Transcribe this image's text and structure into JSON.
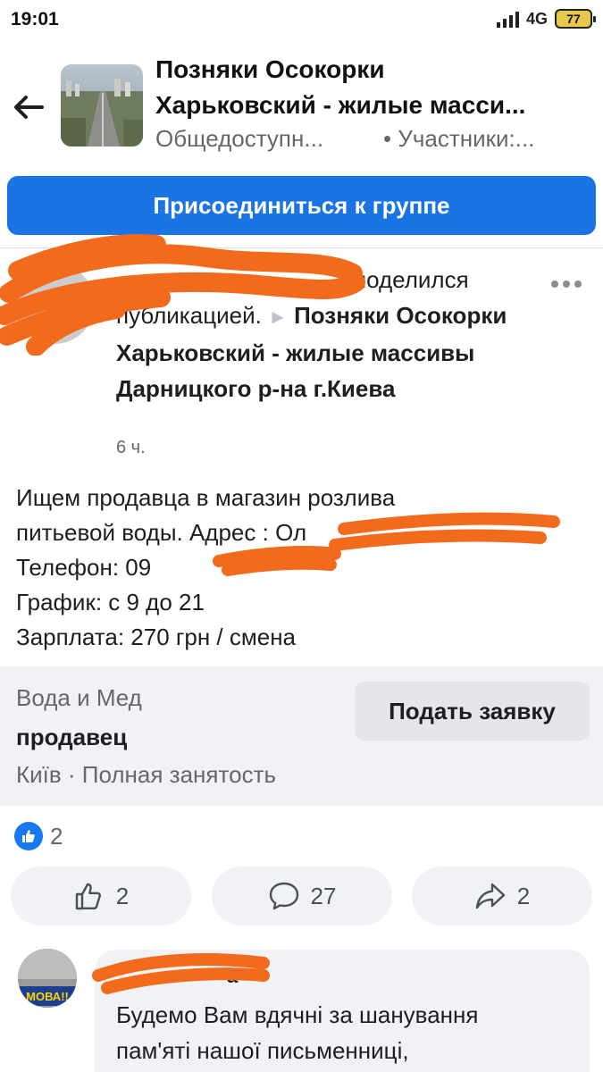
{
  "status_bar": {
    "time": "19:01",
    "network": "4G",
    "battery": "77"
  },
  "group": {
    "title_line1": "Позняки Осокорки",
    "title_line2": "Харьковский - жилые масси...",
    "privacy": "Общедоступн...",
    "members": "• Участники:...",
    "join_label": "Присоединиться к группе"
  },
  "post": {
    "header_plain": "поделился публикацией.",
    "arrow": "►",
    "header_group": "Позняки Осокорки Харьковский - жилые массивы Дарницкого р-на г.Киева",
    "time": "6 ч.",
    "body_lines": [
      "Ищем продавца в магазин розлива",
      "питьевой воды. Адрес : Ол",
      "Телефон: 09",
      "График: с 9 до 21",
      "Зарплата: 270 грн / смена"
    ]
  },
  "job": {
    "company": "Вода и Мед",
    "title": "продавец",
    "location": "Київ · Полная занятость",
    "apply_label": "Подать заявку"
  },
  "reactions": {
    "summary_count": "2",
    "like_count": "2",
    "comment_count": "27",
    "share_count": "2"
  },
  "comment": {
    "author": "а",
    "avatar_text": "МОВА!!",
    "text_line1": "Будемо Вам вдячні за шанування",
    "text_line2": "пам'яті нашої письменниці,"
  },
  "colors": {
    "accent": "#1b74e4",
    "redaction": "#f26a1b",
    "card_bg": "#f0f2f5",
    "secondary_text": "#65676b"
  },
  "icons": [
    "back-arrow-icon",
    "more-icon",
    "like-icon",
    "comment-icon",
    "share-icon"
  ]
}
